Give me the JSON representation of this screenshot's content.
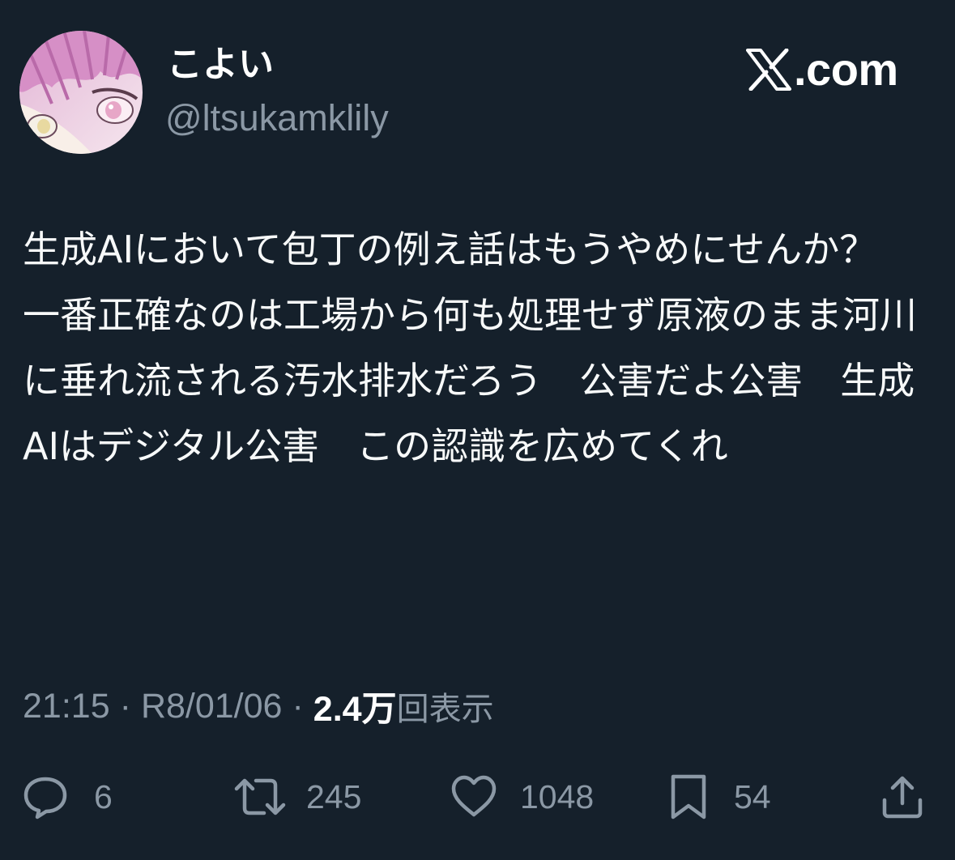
{
  "user": {
    "display_name": "こよい",
    "handle": "@ltsukamklily",
    "avatar_icon": "anime-avatar-icon"
  },
  "brand": {
    "site": ".com",
    "logo_icon": "x-logo-icon"
  },
  "tweet": {
    "text": "生成AIにおいて包丁の例え話はもうやめにせんか？\n一番正確なのは工場から何も処理せず原液のまま河川に垂れ流される汚水排水だろう　公害だよ公害　生成AIはデジタル公害　この認識を広めてくれ"
  },
  "meta": {
    "time": "21:15",
    "date": "R8/01/06",
    "separator": "·",
    "views_count": "2.4万",
    "views_label": "回表示"
  },
  "actions": {
    "reply": {
      "count": "6",
      "icon": "reply-bubble-icon"
    },
    "retweet": {
      "count": "245",
      "icon": "retweet-icon"
    },
    "like": {
      "count": "1048",
      "icon": "heart-icon"
    },
    "bookmark": {
      "count": "54",
      "icon": "bookmark-icon"
    },
    "share": {
      "icon": "share-icon"
    }
  },
  "colors": {
    "background": "#15202b",
    "primary_text": "#ffffff",
    "secondary_text": "#8b98a5"
  }
}
